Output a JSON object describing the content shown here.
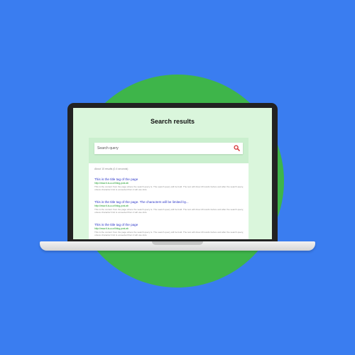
{
  "page": {
    "title": "Search results"
  },
  "search": {
    "placeholder": "Search query"
  },
  "results_count": "About 10 results (0.4 seconds)",
  "results": [
    {
      "title": "This is the title tag of the page",
      "url": "http://www.it-is-a-url/blog-post.ab",
      "snippet": "This is the content from the page where the search query is. The search query will be bold. The text will show 20 words before and after the search query, unless character limit is exceeded then it will use dots."
    },
    {
      "title": "This is the title tag of the page. The characters will be limited by...",
      "url": "http://www.it-is-a-url/blog-post.ab",
      "snippet": "This is the content from the page where the search query is. The search query will be bold. The text will show 20 words before and after the search query, unless character limit is exceeded then it will use dots."
    },
    {
      "title": "This is the title tag of the page",
      "url": "http://www.it-is-a-url/blog-post.ab",
      "snippet": "This is the content from the page where the search query is. The search query will be bold. The text will show 20 words before and after the search query, unless character limit is exceeded then it will use dots."
    }
  ],
  "colors": {
    "background": "#3a7df0",
    "circle": "#3eb54a",
    "screen": "#daf6dc",
    "result_title": "#2b35c8",
    "result_url": "#1a9a2a",
    "search_icon": "#d32f2f"
  },
  "icons": {
    "search": "search-icon"
  }
}
